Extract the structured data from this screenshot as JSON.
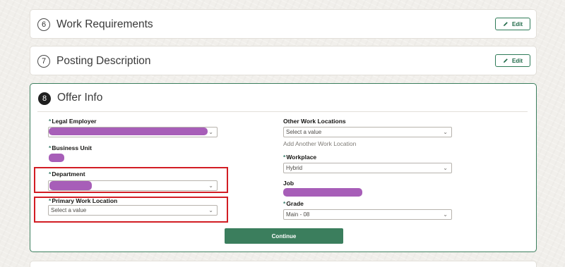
{
  "sections": [
    {
      "num": "6",
      "title": "Work Requirements",
      "edit_label": "Edit"
    },
    {
      "num": "7",
      "title": "Posting Description",
      "edit_label": "Edit"
    }
  ],
  "offer": {
    "num": "8",
    "title": "Offer Info",
    "fields": {
      "legal_employer": {
        "req": "*",
        "label": "Legal Employer"
      },
      "business_unit": {
        "req": "*",
        "label": "Business Unit"
      },
      "department": {
        "req": "*",
        "label": "Department"
      },
      "primary_work_location": {
        "req": "*",
        "label": "Primary Work Location",
        "placeholder": "Select a value"
      },
      "other_work_locations": {
        "label": "Other Work Locations",
        "placeholder": "Select a value",
        "add_link": "Add Another Work Location"
      },
      "workplace": {
        "req": "*",
        "label": "Workplace",
        "value": "Hybrid"
      },
      "job": {
        "label": "Job"
      },
      "grade": {
        "req": "*",
        "label": "Grade",
        "value": "Main - 08"
      }
    },
    "continue_label": "Continue"
  },
  "colors": {
    "accent": "#3b7e5d",
    "highlight": "#d21d24",
    "redaction": "#9d4db0"
  }
}
